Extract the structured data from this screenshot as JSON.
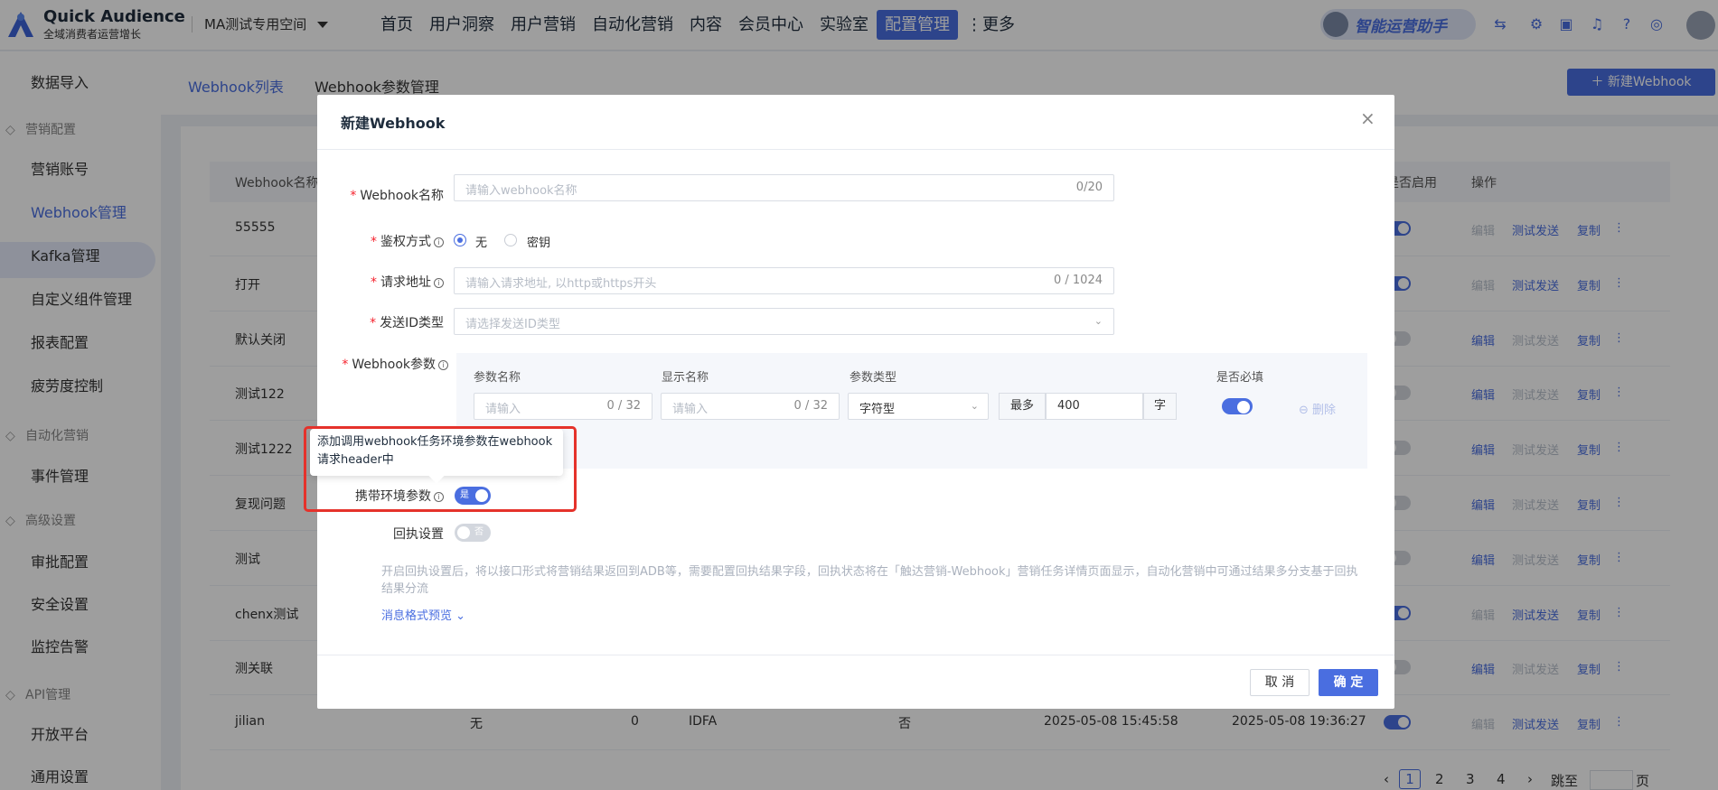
{
  "header": {
    "brand_title": "Quick Audience",
    "brand_subtitle": "全域消费者运营增长",
    "workspace": "MA测试专用空间",
    "nav": [
      "首页",
      "用户洞察",
      "用户营销",
      "自动化营销",
      "内容",
      "会员中心",
      "实验室",
      "配置管理",
      "⋮更多"
    ],
    "active_nav": "配置管理",
    "assistant_label": "智能运营助手"
  },
  "sidebar": {
    "items": [
      {
        "type": "item",
        "label": "数据导入"
      },
      {
        "type": "group",
        "label": "营销配置"
      },
      {
        "type": "item",
        "label": "营销账号"
      },
      {
        "type": "item",
        "label": "Webhook管理",
        "active": true
      },
      {
        "type": "item",
        "label": "Kafka管理"
      },
      {
        "type": "item",
        "label": "自定义组件管理"
      },
      {
        "type": "item",
        "label": "报表配置"
      },
      {
        "type": "item",
        "label": "疲劳度控制"
      },
      {
        "type": "group",
        "label": "自动化营销"
      },
      {
        "type": "item",
        "label": "事件管理"
      },
      {
        "type": "group",
        "label": "高级设置"
      },
      {
        "type": "item",
        "label": "审批配置"
      },
      {
        "type": "item",
        "label": "安全设置"
      },
      {
        "type": "item",
        "label": "监控告警"
      },
      {
        "type": "group",
        "label": "API管理"
      },
      {
        "type": "item",
        "label": "开放平台"
      },
      {
        "type": "item",
        "label": "通用设置"
      }
    ]
  },
  "page": {
    "tabs": [
      "Webhook列表",
      "Webhook参数管理"
    ],
    "new_button": "新建Webhook",
    "table": {
      "headers": [
        "Webhook名称",
        "是否启用",
        "操作"
      ],
      "rows": [
        {
          "name": "55555",
          "enabled": true
        },
        {
          "name": "打开",
          "enabled": true
        },
        {
          "name": "默认关闭",
          "enabled": false
        },
        {
          "name": "测试122",
          "enabled": false
        },
        {
          "name": "测试1222",
          "enabled": false
        },
        {
          "name": "复现问题",
          "enabled": false
        },
        {
          "name": "测试",
          "enabled": false
        },
        {
          "name": "chenx测试",
          "enabled": true
        },
        {
          "name": "测关联",
          "enabled": false
        },
        {
          "name": "jilian",
          "enabled": true,
          "auth": "无",
          "count": "0",
          "id_type": "IDFA",
          "required": "否",
          "created": "2025-05-08 15:45:58",
          "updated": "2025-05-08 19:36:27"
        }
      ],
      "ops": {
        "edit": "编辑",
        "test": "测试发送",
        "copy": "复制",
        "more": "⋮"
      }
    },
    "pagination": {
      "pages": [
        "1",
        "2",
        "3",
        "4"
      ],
      "prev": "‹",
      "next": "›",
      "goto_label": "跳至",
      "page_suffix": "页"
    }
  },
  "modal": {
    "title": "新建Webhook",
    "close": "×",
    "name_label": "Webhook名称",
    "name_placeholder": "请输入webhook名称",
    "name_count": "0/20",
    "auth_label": "鉴权方式",
    "auth_options": [
      "无",
      "密钥"
    ],
    "url_label": "请求地址",
    "url_placeholder": "请输入请求地址, 以http或https开头",
    "url_count": "0 / 1024",
    "idtype_label": "发送ID类型",
    "idtype_placeholder": "请选择发送ID类型",
    "params_label": "Webhook参数",
    "params": {
      "col_name": "参数名称",
      "col_display": "显示名称",
      "col_type": "参数类型",
      "col_required": "是否必填",
      "name_placeholder": "请输入",
      "name_count": "0 / 32",
      "display_placeholder": "请输入",
      "display_count": "0 / 32",
      "type_value": "字符型",
      "max_prefix": "最多",
      "max_value": "400",
      "max_suffix": "字",
      "delete": "删除"
    },
    "env_label": "携带环境参数",
    "env_toggle_text": "是",
    "callback_label": "回执设置",
    "callback_toggle_text": "否",
    "description": "开启回执设置后，将以接口形式将营销结果返回到ADB等，需要配置回执结果字段，回执状态将在「触达营销-Webhook」营销任务详情页面显示，自动化营销中可通过结果多分支基于回执结果分流",
    "preview_link": "消息格式预览",
    "cancel": "取 消",
    "confirm": "确 定",
    "tooltip": "添加调用webhook任务环境参数在webhook请求header中"
  },
  "colors": {
    "primary": "#4a6ee0",
    "highlight": "#e5322b",
    "required": "#f5222d"
  }
}
